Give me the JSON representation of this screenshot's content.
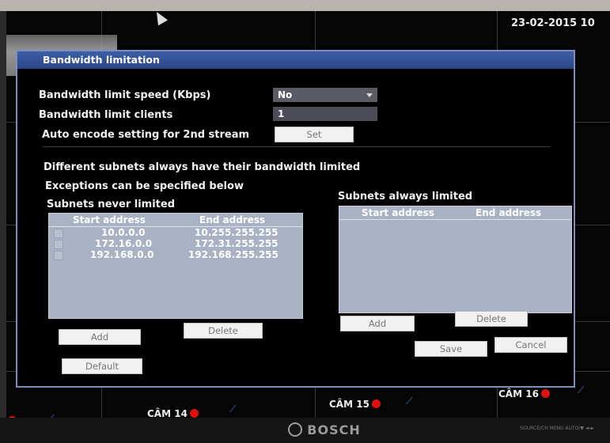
{
  "screen": {
    "datetime": "23-02-2015 10",
    "brand": "BOSCH",
    "bezel_text": "SOURCE/CH  MENU  AUTO/▼  ◄  ►",
    "cameras": [
      {
        "label": "CÂM 14"
      },
      {
        "label": "CÂM 15"
      },
      {
        "label": "CÂM 16"
      }
    ]
  },
  "dialog": {
    "title": "Bandwidth limitation",
    "speed_label": "Bandwidth limit speed  (Kbps)",
    "speed_value": "No",
    "clients_label": "Bandwidth limit clients",
    "clients_value": "1",
    "auto_encode_label": "Auto encode setting for 2nd stream",
    "set_button": "Set",
    "info_line1": "Different subnets always have their bandwidth limited",
    "info_line2": "Exceptions can be specified below",
    "never_limited": {
      "title": "Subnets never limited",
      "col_start": "Start address",
      "col_end": "End address",
      "rows": [
        {
          "start": "10.0.0.0",
          "end": "10.255.255.255"
        },
        {
          "start": "172.16.0.0",
          "end": "172.31.255.255"
        },
        {
          "start": "192.168.0.0",
          "end": "192.168.255.255"
        }
      ],
      "add_button": "Add",
      "delete_button": "Delete"
    },
    "always_limited": {
      "title": "Subnets always limited",
      "col_start": "Start address",
      "col_end": "End address",
      "add_button": "Add",
      "delete_button": "Delete"
    },
    "default_button": "Default",
    "save_button": "Save",
    "cancel_button": "Cancel"
  }
}
